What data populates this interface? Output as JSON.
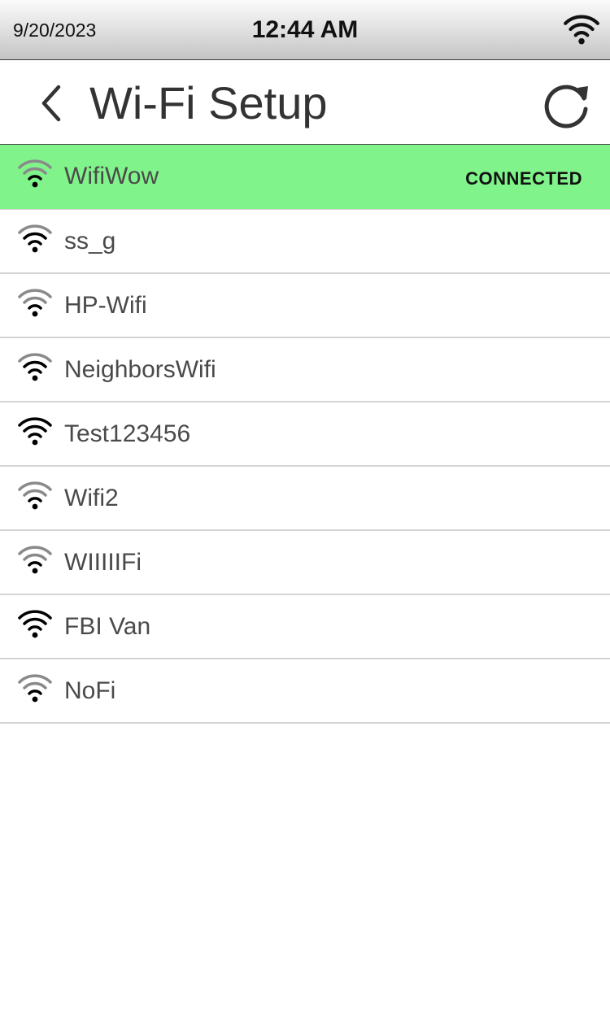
{
  "status_bar": {
    "date": "9/20/2023",
    "time": "12:44 AM",
    "icon": "wifi-icon"
  },
  "header": {
    "title": "Wi-Fi Setup",
    "back_icon": "chevron-left-icon",
    "refresh_icon": "refresh-icon"
  },
  "colors": {
    "connected_bg": "#80f48a",
    "text": "#4a4a4a",
    "divider": "#d4d4d4",
    "wifi_strong": "#000000",
    "wifi_weak": "#8a8a8a"
  },
  "networks": [
    {
      "name": "WifiWow",
      "status": "CONNECTED",
      "signal_bars": 1
    },
    {
      "name": "ss_g",
      "status": "",
      "signal_bars": 2
    },
    {
      "name": "HP-Wifi",
      "status": "",
      "signal_bars": 1
    },
    {
      "name": "NeighborsWifi",
      "status": "",
      "signal_bars": 2
    },
    {
      "name": "Test123456",
      "status": "",
      "signal_bars": 3
    },
    {
      "name": "Wifi2",
      "status": "",
      "signal_bars": 1
    },
    {
      "name": "WIIIIIFi",
      "status": "",
      "signal_bars": 1
    },
    {
      "name": "FBI Van",
      "status": "",
      "signal_bars": 3
    },
    {
      "name": "NoFi",
      "status": "",
      "signal_bars": 1
    }
  ]
}
